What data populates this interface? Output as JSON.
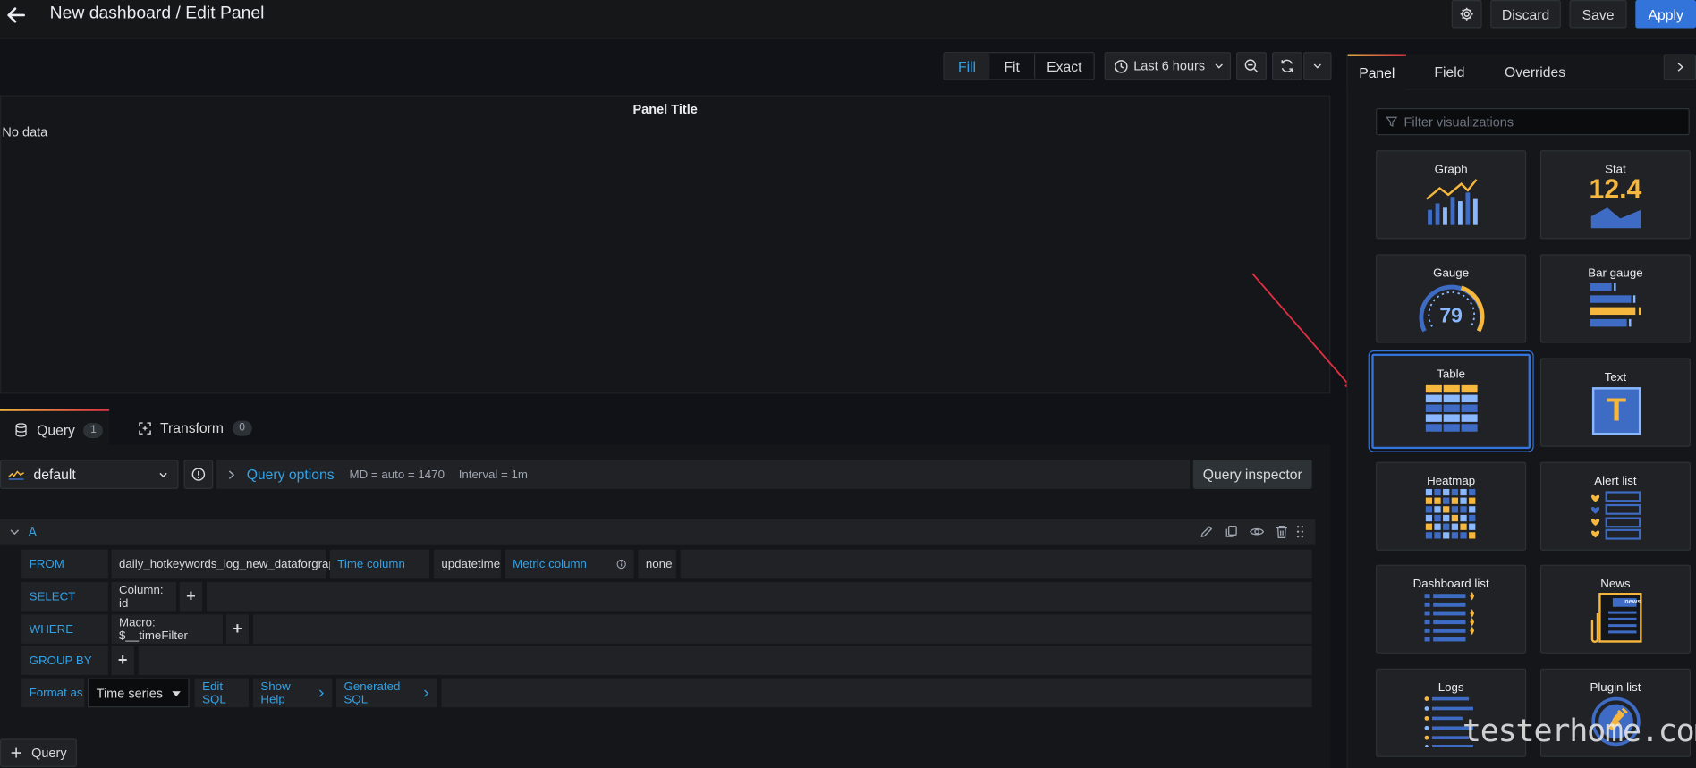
{
  "header": {
    "title": "New dashboard / Edit Panel",
    "discard_label": "Discard",
    "save_label": "Save",
    "apply_label": "Apply"
  },
  "toolbar": {
    "fill_label": "Fill",
    "fit_label": "Fit",
    "exact_label": "Exact",
    "time_range": "Last 6 hours"
  },
  "panel": {
    "title": "Panel Title",
    "no_data": "No data"
  },
  "query_tabs": [
    {
      "label": "Query",
      "count": "1"
    },
    {
      "label": "Transform",
      "count": "0"
    }
  ],
  "datasource": {
    "name": "default",
    "query_options_label": "Query options",
    "md_info": "MD = auto = 1470",
    "interval_info": "Interval = 1m",
    "inspector_label": "Query inspector"
  },
  "query": {
    "ref_id": "A",
    "from_label": "FROM",
    "table": "daily_hotkeywords_log_new_dataforgraph",
    "time_column_label": "Time column",
    "time_column": "updatetime",
    "metric_column_label": "Metric column",
    "metric_column": "none",
    "select_label": "SELECT",
    "select_value": "Column: id",
    "where_label": "WHERE",
    "where_value": "Macro: $__timeFilter",
    "group_by_label": "GROUP BY",
    "format_as_label": "Format as",
    "format_value": "Time series",
    "edit_sql_label": "Edit SQL",
    "show_help_label": "Show Help",
    "generated_sql_label": "Generated SQL",
    "plus": "+"
  },
  "add_query_label": "Query",
  "side_tabs": {
    "panel_label": "Panel",
    "field_label": "Field",
    "overrides_label": "Overrides"
  },
  "filter_placeholder": "Filter visualizations",
  "visualizations": [
    {
      "name": "Graph"
    },
    {
      "name": "Stat",
      "value": "12.4"
    },
    {
      "name": "Gauge",
      "value": "79"
    },
    {
      "name": "Bar gauge"
    },
    {
      "name": "Table",
      "selected": true
    },
    {
      "name": "Text",
      "glyph": "T"
    },
    {
      "name": "Heatmap"
    },
    {
      "name": "Alert list"
    },
    {
      "name": "Dashboard list"
    },
    {
      "name": "News",
      "glyph": "news"
    },
    {
      "name": "Logs"
    },
    {
      "name": "Plugin list"
    }
  ],
  "watermark": "testerhome.com",
  "colors": {
    "accent_blue": "#3274d9",
    "link_blue": "#33a2e5",
    "viz_orange": "#f5b73d",
    "viz_blue": "#3e6bc4",
    "annotation_red": "#e02f44"
  }
}
